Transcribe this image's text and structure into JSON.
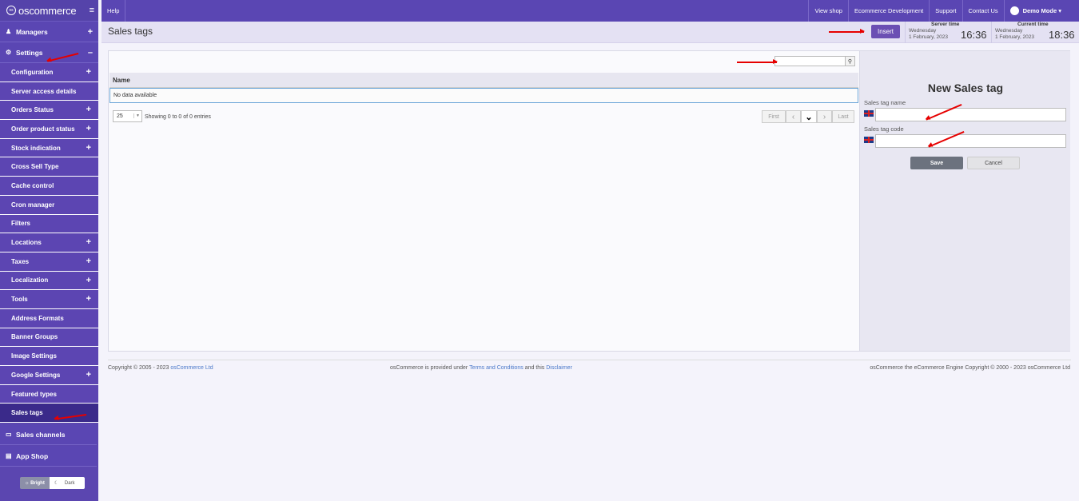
{
  "app": {
    "logo": "oscommerce",
    "logo_mark": "os"
  },
  "sidebar": {
    "managers": "Managers",
    "settings": "Settings",
    "items": [
      {
        "label": "Configuration",
        "expand": "+"
      },
      {
        "label": "Server access details",
        "expand": ""
      },
      {
        "label": "Orders Status",
        "expand": "+"
      },
      {
        "label": "Order product status",
        "expand": "+"
      },
      {
        "label": "Stock indication",
        "expand": "+"
      },
      {
        "label": "Cross Sell Type",
        "expand": ""
      },
      {
        "label": "Cache control",
        "expand": ""
      },
      {
        "label": "Cron manager",
        "expand": ""
      },
      {
        "label": "Filters",
        "expand": ""
      },
      {
        "label": "Locations",
        "expand": "+"
      },
      {
        "label": "Taxes",
        "expand": "+"
      },
      {
        "label": "Localization",
        "expand": "+"
      },
      {
        "label": "Tools",
        "expand": "+"
      },
      {
        "label": "Address Formats",
        "expand": ""
      },
      {
        "label": "Banner Groups",
        "expand": ""
      },
      {
        "label": "Image Settings",
        "expand": ""
      },
      {
        "label": "Google Settings",
        "expand": "+"
      },
      {
        "label": "Featured types",
        "expand": ""
      },
      {
        "label": "Sales tags",
        "expand": ""
      }
    ],
    "sales_channels": "Sales channels",
    "app_shop": "App Shop",
    "theme_bright": "Bright",
    "theme_dark": "Dark"
  },
  "topbar": {
    "help": "Help",
    "view_shop": "View shop",
    "ecommerce_dev": "Ecommerce Development",
    "support": "Support",
    "contact": "Contact Us",
    "user": "Demo Mode"
  },
  "header": {
    "title": "Sales tags",
    "insert": "Insert",
    "server_time_label": "Server time",
    "server_day": "Wednesday",
    "server_date": "1 February, 2023",
    "server_time": "16:36",
    "current_time_label": "Current time",
    "current_day": "Wednesday",
    "current_date": "1 February, 2023",
    "current_time": "18:36"
  },
  "table": {
    "col_name": "Name",
    "no_data": "No data available",
    "page_size": "25",
    "showing": "Showing 0 to 0 of 0 entries",
    "first": "First",
    "last": "Last",
    "prev": "‹",
    "next": "›",
    "page_dropdown": "⌄"
  },
  "form": {
    "title": "New Sales tag",
    "name_label": "Sales tag name",
    "code_label": "Sales tag code",
    "save": "Save",
    "cancel": "Cancel"
  },
  "footer": {
    "copyright": "Copyright © 2005 - 2023 ",
    "company": "osCommerce Ltd",
    "provided": "osCommerce is provided under ",
    "terms": "Terms and Conditions",
    "and_this": " and this ",
    "disclaimer": "Disclaimer",
    "engine": "osCommerce the eCommerce Engine Copyright © 2000 - 2023 osCommerce Ltd"
  }
}
